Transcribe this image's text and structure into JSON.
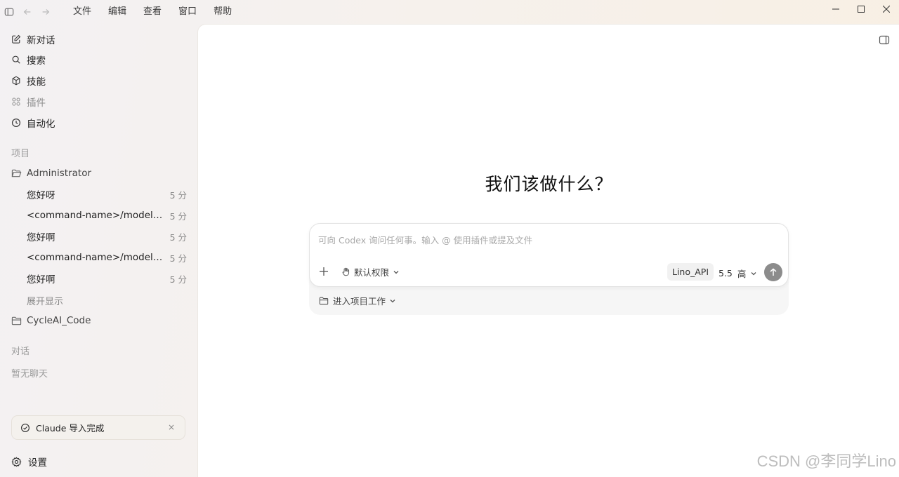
{
  "menu": [
    "文件",
    "编辑",
    "查看",
    "窗口",
    "帮助"
  ],
  "sidebar": {
    "nav": [
      {
        "label": "新对话",
        "icon": "edit-icon"
      },
      {
        "label": "搜索",
        "icon": "search-icon"
      },
      {
        "label": "技能",
        "icon": "cube-icon"
      },
      {
        "label": "插件",
        "icon": "grid-icon"
      },
      {
        "label": "自动化",
        "icon": "clock-icon"
      }
    ],
    "projects_label": "项目",
    "projects": [
      {
        "name": "Administrator",
        "chats": [
          {
            "title": "您好呀",
            "time": "5 分"
          },
          {
            "title": "<command-name>/model</command-name>",
            "time": "5 分"
          },
          {
            "title": "您好啊",
            "time": "5 分"
          },
          {
            "title": "<command-name>/model</command-name>",
            "time": "5 分"
          },
          {
            "title": "您好啊",
            "time": "5 分"
          }
        ],
        "expand_label": "展开显示"
      },
      {
        "name": "CycleAI_Code"
      }
    ],
    "conversations_label": "对话",
    "no_chats": "暂无聊天",
    "toast": {
      "message": "Claude 导入完成",
      "close": "×"
    },
    "settings_label": "设置"
  },
  "main": {
    "headline": "我们该做什么？",
    "composer": {
      "placeholder": "可向 Codex 询问任何事。输入 @ 使用插件或提及文件",
      "permission": "默认权限",
      "provider": "Lino_API",
      "model_version": "5.5",
      "reasoning": "高"
    },
    "workspace_label": "进入项目工作"
  },
  "watermark": "CSDN @李同学Lino",
  "colors": {
    "send_button": "#8c8c8c",
    "main_bg": "#ffffff"
  }
}
